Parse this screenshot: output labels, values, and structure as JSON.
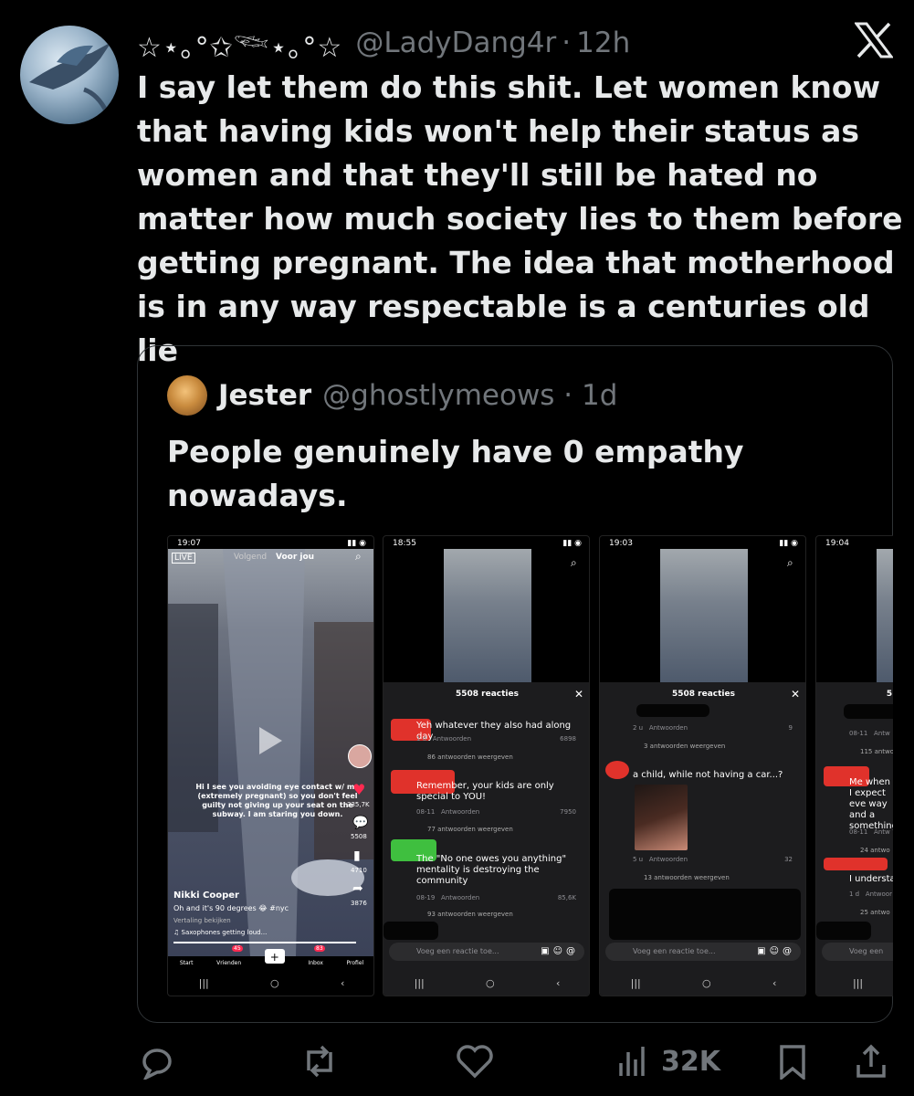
{
  "author": {
    "display_deco": "☆⋆｡°✩𓆝⋆｡°☆",
    "handle": "@LadyDang4r",
    "time": "12h"
  },
  "tweet_text": "I say let them do this shit. Let women know that having kids won't help their status as women and that they'll still be hated no matter how much society lies to them before getting pregnant. The idea that motherhood is in any way respectable is a centuries old lie",
  "quoted": {
    "name": "Jester",
    "handle": "@ghostlymeows",
    "time": "1d",
    "text": "People genuinely have 0 empathy nowadays.",
    "shots": [
      {
        "status_time": "19:07",
        "tabs": [
          "Volgend",
          "Voor jou"
        ],
        "live": "LIVE",
        "caption": "Hi I see you avoiding eye contact w/ me (extremely pregnant) so you don't feel guilty not giving up your seat on the subway. I am staring you down.",
        "likes": "335,7K",
        "comments": "5508",
        "saves": "4710",
        "shares": "3876",
        "user": "Nikki Cooper",
        "desc": "Oh and it's 90 degrees 😂 #nyc",
        "translate": "Vertaling bekijken",
        "sound": "♫ Saxophones getting loud...",
        "nav": [
          "Start",
          "Vrienden",
          "Inbox",
          "Profiel"
        ],
        "nav_badges": [
          "45",
          "83"
        ]
      },
      {
        "status_time": "18:55",
        "sheet_title": "5508 reacties",
        "comments": [
          {
            "text": "Yeh whatever they also had along day",
            "age": "1 d",
            "reply": "Antwoorden",
            "likes": "6898",
            "more": "86 antwoorden weergeven"
          },
          {
            "text": "Remember, your kids are only special to YOU!",
            "age": "08-11",
            "reply": "Antwoorden",
            "likes": "7950",
            "more": "77 antwoorden weergeven"
          },
          {
            "text": "The \"No one owes you anything\" mentality is destroying the community",
            "age": "08-19",
            "reply": "Antwoorden",
            "likes": "85,6K",
            "more": "93 antwoorden weergeven"
          }
        ],
        "input_placeholder": "Voeg een reactie toe..."
      },
      {
        "status_time": "19:03",
        "sheet_title": "5508 reacties",
        "top_meta": {
          "age": "2 u",
          "reply": "Antwoorden",
          "likes": "9",
          "more": "3 antwoorden weergeven"
        },
        "comment": {
          "text": "a child, while not having a car...?",
          "age": "5 u",
          "reply": "Antwoorden",
          "likes": "32",
          "more": "13 antwoorden weergeven"
        },
        "input_placeholder": "Voeg een reactie toe..."
      },
      {
        "status_time": "19:04",
        "sheet_title": "5",
        "meta_1": {
          "age": "08-11",
          "reply": "Antw",
          "more": "115 antwo"
        },
        "comment_1": "Me when I expect eve way and a something",
        "meta_2": {
          "age": "08-11",
          "reply": "Antw",
          "more": "24 antwo"
        },
        "comment_2": "I understa",
        "meta_3": {
          "age": "1 d",
          "reply": "Antwoor",
          "more": "25 antwo"
        },
        "input_placeholder": "Voeg een"
      }
    ]
  },
  "actions": {
    "views": "32K"
  }
}
